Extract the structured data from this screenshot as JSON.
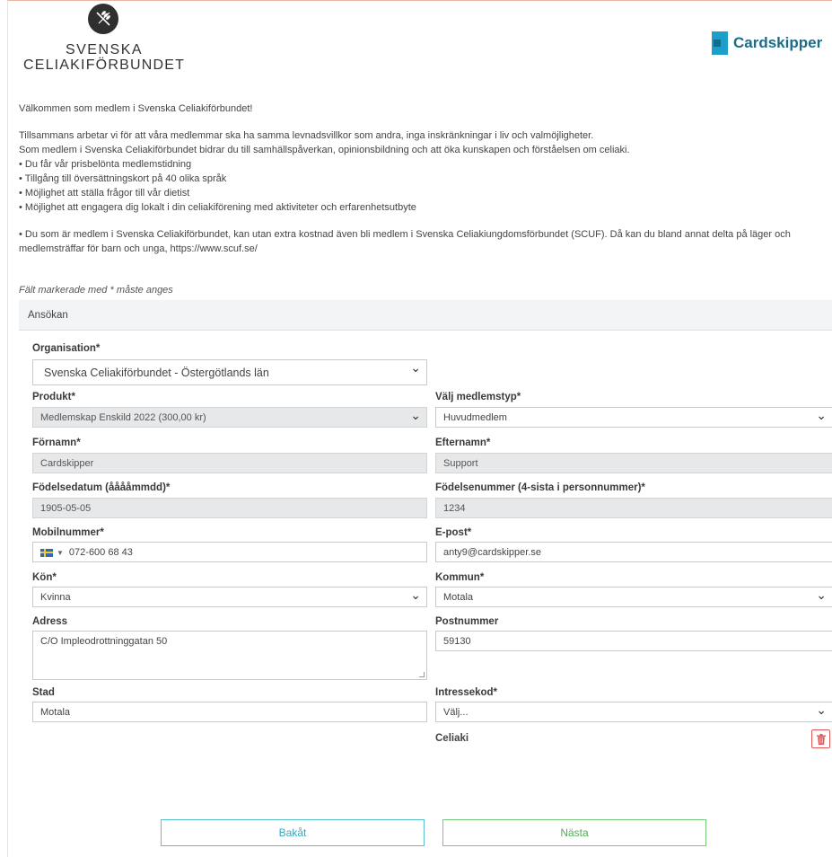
{
  "brand": {
    "name_line1": "SVENSKA",
    "name_line2": "CELIAKIFÖRBUNDET",
    "partner": "Cardskipper"
  },
  "intro": {
    "welcome": "Välkommen som medlem i Svenska Celiakiförbundet!",
    "p1": "Tillsammans arbetar vi för att våra medlemmar ska ha samma levnadsvillkor som andra, inga inskränkningar i liv och valmöjligheter.",
    "p2": "Som medlem i Svenska Celiakiförbundet bidrar du till samhällspåverkan, opinionsbildning och att öka kunskapen och förståelsen om celiaki.",
    "b1": "• Du får vår prisbelönta medlemstidning",
    "b2": "• Tillgång till översättningskort på 40 olika språk",
    "b3": "• Möjlighet att ställa frågor till vår dietist",
    "b4": "• Möjlighet att engagera dig lokalt i din celiakiförening med aktiviteter och erfarenhetsutbyte",
    "b5a": "• Du som är medlem i Svenska Celiakiförbundet, kan utan extra kostnad även bli medlem i Svenska Celiakiungdomsförbundet (SCUF). Då kan du bland annat delta på läger och",
    "b5b": "medlemsträffar för barn och unga, https://www.scuf.se/"
  },
  "form": {
    "required_note": "Fält markerade med * måste anges",
    "section_title": "Ansökan",
    "organisation": {
      "label": "Organisation*",
      "value": "Svenska Celiakiförbundet - Östergötlands län"
    },
    "produkt": {
      "label": "Produkt*",
      "value": "Medlemskap Enskild 2022 (300,00 kr)"
    },
    "medlemstyp": {
      "label": "Välj medlemstyp*",
      "value": "Huvudmedlem"
    },
    "fornamn": {
      "label": "Förnamn*",
      "value": "Cardskipper"
    },
    "efternamn": {
      "label": "Efternamn*",
      "value": "Support"
    },
    "fodelsedatum": {
      "label": "Födelsedatum (ååååmmdd)*",
      "value": "1905-05-05"
    },
    "fodelsenummer": {
      "label": "Födelsenummer (4-sista i personnummer)*",
      "value": "1234"
    },
    "mobil": {
      "label": "Mobilnummer*",
      "value": "072-600 68 43"
    },
    "epost": {
      "label": "E-post*",
      "value": "anty9@cardskipper.se"
    },
    "kon": {
      "label": "Kön*",
      "value": "Kvinna"
    },
    "kommun": {
      "label": "Kommun*",
      "value": "Motala"
    },
    "adress": {
      "label": "Adress",
      "value": "C/O Impleodrottninggatan 50"
    },
    "postnummer": {
      "label": "Postnummer",
      "value": "59130"
    },
    "stad": {
      "label": "Stad",
      "value": "Motala"
    },
    "intressekod": {
      "label": "Intressekod*",
      "value": "Välj..."
    },
    "selected_interest": "Celiaki"
  },
  "buttons": {
    "back": "Bakåt",
    "next": "Nästa"
  },
  "colors": {
    "accent_back": "#35a9bb",
    "accent_next": "#50ad52",
    "delete": "#e05656"
  }
}
